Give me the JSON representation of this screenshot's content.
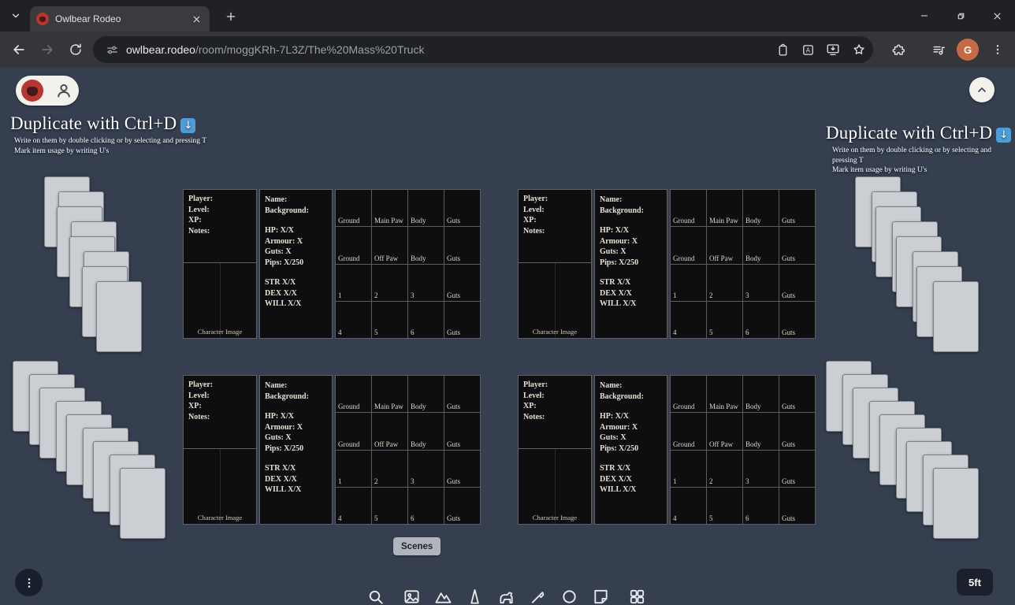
{
  "browser": {
    "tab_title": "Owlbear Rodeo",
    "url_domain": "owlbear.rodeo",
    "url_path": "/room/moggKRh-7L3Z/The%20Mass%20Truck",
    "avatar_letter": "G"
  },
  "hints": {
    "left": {
      "title": "Duplicate with Ctrl+D",
      "arrow": "↓",
      "line1": "Write on them by double clicking or by selecting and pressing T",
      "line2": "Mark item usage by writing U's"
    },
    "right": {
      "title": "Duplicate with Ctrl+D",
      "arrow": "↓",
      "line1": "Write on them by double clicking or by selecting and pressing T",
      "line2": "Mark item usage by writing U's"
    }
  },
  "sheet": {
    "left_labels": [
      "Player:",
      "Level:",
      "XP:",
      "Notes:"
    ],
    "image_label": "Character Image",
    "mid_top": [
      "Name:",
      "Background:"
    ],
    "mid_stats": [
      "HP: X/X",
      "Armour: X",
      "Guts: X",
      "Pips: X/250"
    ],
    "mid_attrs": [
      "STR X/X",
      "DEX X/X",
      "WILL X/X"
    ],
    "grid": [
      [
        "Ground",
        "Main Paw",
        "Body",
        "Guts"
      ],
      [
        "Ground",
        "Off Paw",
        "Body",
        "Guts"
      ],
      [
        "1",
        "2",
        "3",
        "Guts"
      ],
      [
        "4",
        "5",
        "6",
        "Guts"
      ]
    ]
  },
  "footer": {
    "scenes": "Scenes",
    "scale": "5ft"
  },
  "tools": [
    "search",
    "image",
    "mountain",
    "pointer",
    "token",
    "attachment",
    "ring",
    "note",
    "grid"
  ]
}
